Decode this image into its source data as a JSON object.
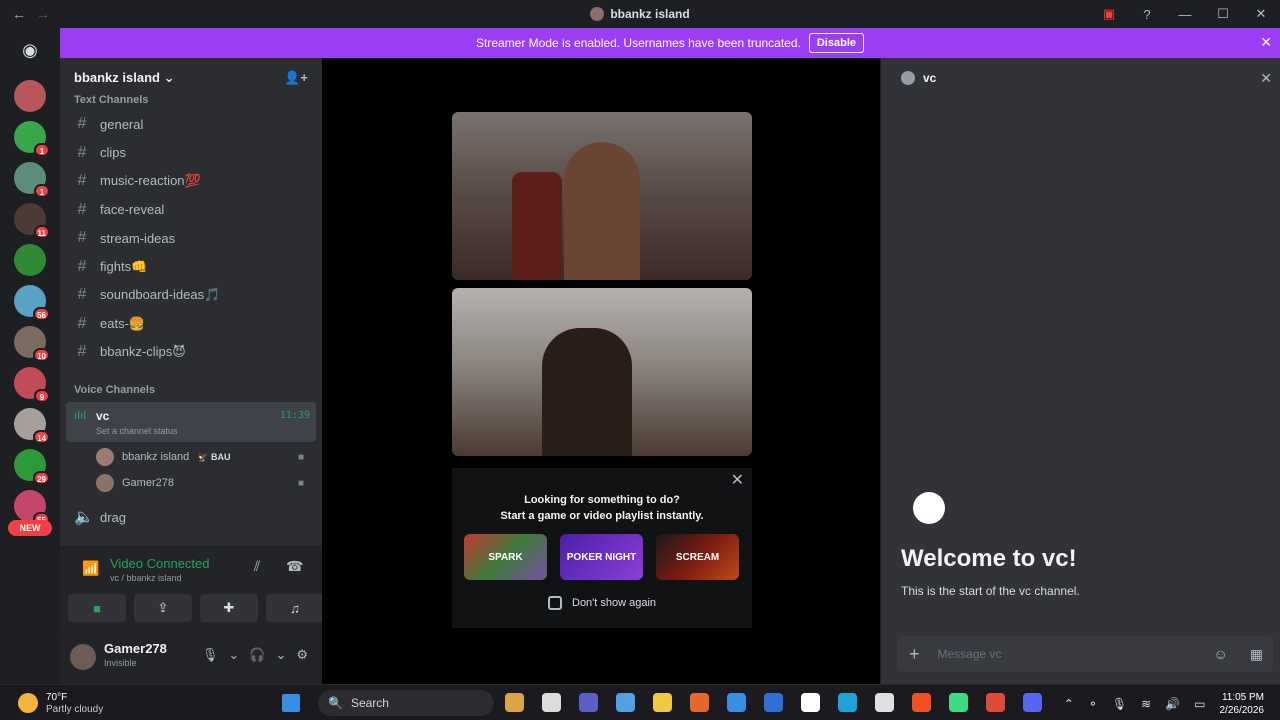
{
  "window": {
    "title": "bbankz island"
  },
  "banner": {
    "text": "Streamer Mode is enabled. Usernames have been truncated.",
    "button": "Disable"
  },
  "guilds": {
    "items": [
      {
        "color": "#b9565a",
        "badge": ""
      },
      {
        "color": "#3aa64a",
        "badge": "1"
      },
      {
        "color": "#5c8c7a",
        "badge": "1"
      },
      {
        "color": "#4a3b34",
        "badge": "11"
      },
      {
        "color": "#2f8a34",
        "badge": ""
      },
      {
        "color": "#5aa2c4",
        "badge": "56"
      },
      {
        "color": "#7a6a62",
        "badge": "10"
      },
      {
        "color": "#c34b58",
        "badge": "9"
      },
      {
        "color": "#a7a09a",
        "badge": "14"
      },
      {
        "color": "#2d9a3a",
        "badge": "29"
      },
      {
        "color": "#c2476a",
        "badge": "55"
      }
    ],
    "new_label": "NEW"
  },
  "server": {
    "name": "bbankz island"
  },
  "text_category": "Text Channels",
  "channels": [
    {
      "name": "general",
      "emoji": ""
    },
    {
      "name": "clips",
      "emoji": ""
    },
    {
      "name": "music-reaction",
      "emoji": "💯"
    },
    {
      "name": "face-reveal",
      "emoji": ""
    },
    {
      "name": "stream-ideas",
      "emoji": ""
    },
    {
      "name": "fights",
      "emoji": "👊"
    },
    {
      "name": "soundboard-ideas",
      "emoji": "🎵"
    },
    {
      "name": "eats-",
      "emoji": "🍔"
    },
    {
      "name": "bbankz-clips",
      "emoji": "😈"
    }
  ],
  "voice_category": "Voice Channels",
  "voice": {
    "name": "vc",
    "status": "Set a channel status",
    "timer": "11:39",
    "users": [
      {
        "name": "bbankz island",
        "tag": "🦅 BAU"
      },
      {
        "name": "Gamer278",
        "tag": ""
      }
    ],
    "other_channel": "drag"
  },
  "rtc": {
    "title": "Video Connected",
    "subtitle": "vc / bbankz island"
  },
  "user": {
    "name": "Gamer278",
    "status": "Invisible"
  },
  "activity": {
    "line1": "Looking for something to do?",
    "line2": "Start a game or video playlist instantly.",
    "games": [
      "SPARK",
      "POKER NIGHT",
      "SCREAM"
    ],
    "checkbox_label": "Don't show again"
  },
  "chat": {
    "channel": "vc",
    "welcome": "Welcome to vc!",
    "start": "This is the start of the vc channel.",
    "placeholder": "Message vc"
  },
  "taskbar": {
    "temp": "70°F",
    "weather": "Partly cloudy",
    "search": "Search",
    "time": "11:05 PM",
    "date": "2/26/2026",
    "apps": [
      "#d9a441",
      "#dcdcdc",
      "#5b5fc7",
      "#4fa3e0",
      "#f2c744",
      "#e8652b",
      "#3a8ee6",
      "#2f6fd6",
      "#ffffff",
      "#1fa2d8",
      "#e0e0e0",
      "#f25022",
      "#3ddc84",
      "#dd4b39",
      "#5865f2"
    ]
  }
}
